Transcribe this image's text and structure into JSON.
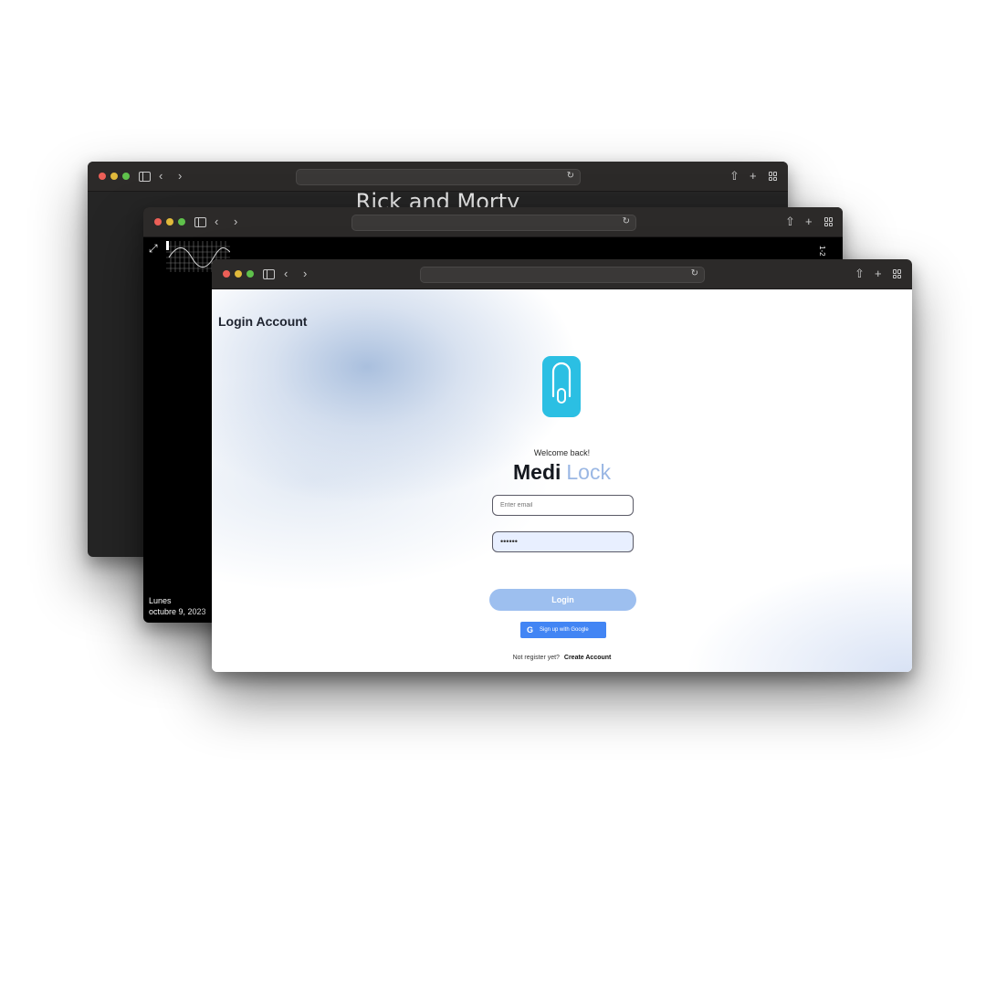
{
  "windows": {
    "back": {
      "content_title": "Rick and Morty"
    },
    "middle": {
      "date_day": "Lunes",
      "date_full": "octubre 9, 2023",
      "vertical_text": "1-2"
    },
    "front": {
      "page_title": "Login Account",
      "welcome": "Welcome back!",
      "brand_part1": "Medi",
      "brand_part2": "Lock",
      "email_placeholder": "Enter email",
      "password_value": "••••••",
      "login_label": "Login",
      "google_label": "Sign up with Google",
      "signup_prompt": "Not register yet?",
      "create_account_label": "Create Account"
    }
  },
  "icons": {
    "reload": "↻",
    "back": "‹",
    "forward": "›",
    "share": "⇧",
    "new_tab": "+",
    "expand": "⤢",
    "google": "G"
  },
  "colors": {
    "accent": "#9dbfef",
    "brand_blue": "#9ab7e4",
    "logo": "#2bbfe3",
    "google": "#4285f4"
  }
}
